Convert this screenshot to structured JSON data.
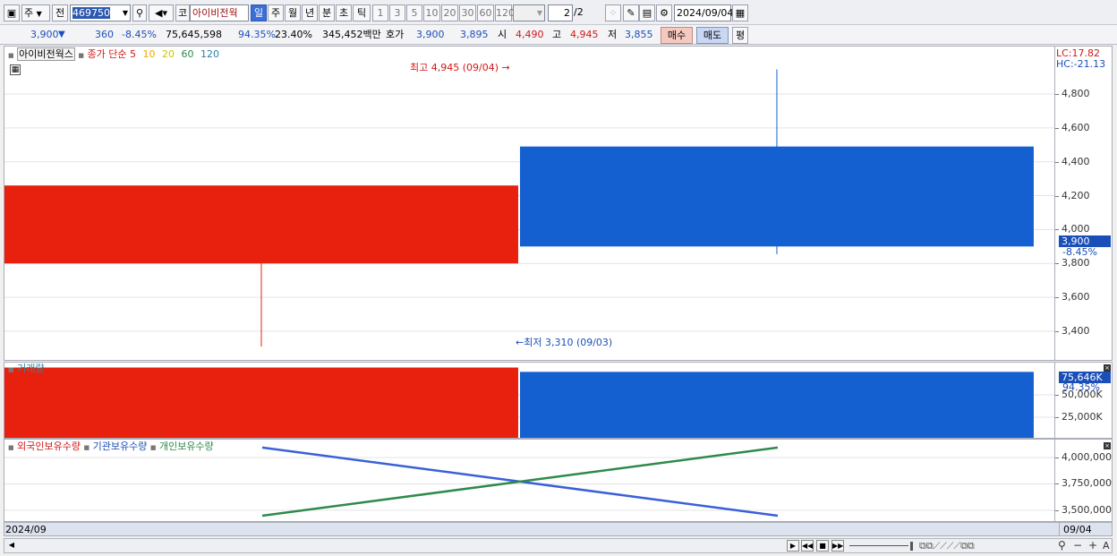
{
  "toolbar": {
    "market": "주",
    "prev": "전",
    "code": "469750",
    "market_type": "코",
    "stock_name": "아이비전웍",
    "periods": [
      "일",
      "주",
      "월",
      "년",
      "분",
      "초",
      "틱"
    ],
    "selected_period": "일",
    "intervals": [
      "1",
      "3",
      "5",
      "10",
      "20",
      "30",
      "60",
      "120"
    ],
    "page": "2",
    "page_total": "/2",
    "date": "2024/09/04"
  },
  "quote": {
    "price": "3,900",
    "arrow": "▼",
    "change": "360",
    "change_pct": "-8.45%",
    "volume": "75,645,598",
    "vol_ratio": "94.35%",
    "turnover": "23.40%",
    "amount": "345,452백만",
    "hoga_label": "호가",
    "ask": "3,900",
    "bid": "3,895",
    "open_label": "시",
    "open": "4,490",
    "high_label": "고",
    "high": "4,945",
    "low_label": "저",
    "low": "3,855",
    "buy_label": "매수",
    "sell_label": "매도",
    "flat_label": "평"
  },
  "price_pane": {
    "stock_label": "아이비전웍스",
    "ma_label": "종가 단순",
    "ma_periods": [
      "5",
      "10",
      "20",
      "60",
      "120"
    ],
    "ma_colors": [
      "#d01818",
      "#f0a800",
      "#c8c800",
      "#2e8a4a",
      "#2a7fb0"
    ],
    "high_annotation": "최고 4,945 (09/04)",
    "low_annotation": "최저 3,310 (09/03)",
    "lc": "LC:17.82",
    "hc": "HC:-21.13",
    "current_tag": "3,900",
    "current_pct": "-8.45%"
  },
  "volume_pane": {
    "label": "거래량",
    "current_tag": "75,646K",
    "ratio": "94.35%"
  },
  "holdings_pane": {
    "legend": [
      "외국인보유수량",
      "기관보유수량",
      "개인보유수량"
    ],
    "legend_colors": [
      "#d01818",
      "#1b4fb8",
      "#2e8a4a"
    ]
  },
  "footer": {
    "left_date": "2024/09",
    "right_date": "09/04"
  },
  "chart_data": [
    {
      "type": "candlestick",
      "categories": [
        "09/03",
        "09/04"
      ],
      "candles": [
        {
          "date": "09/03",
          "open": 3800,
          "high": 4260,
          "low": 3310,
          "close": 4260,
          "color": "#e8200e"
        },
        {
          "date": "09/04",
          "open": 4490,
          "high": 4945,
          "low": 3855,
          "close": 3900,
          "color": "#1560d0"
        }
      ],
      "yticks": [
        3400,
        3600,
        3800,
        4000,
        4200,
        4400,
        4600,
        4800
      ],
      "ytick_labels": [
        "3,400",
        "3,600",
        "3,800",
        "4,000",
        "4,200",
        "4,400",
        "4,600",
        "4,800"
      ],
      "ylim": [
        3220,
        5080
      ]
    },
    {
      "type": "bar",
      "categories": [
        "09/03",
        "09/04"
      ],
      "values": [
        80500,
        75646
      ],
      "colors": [
        "#e8200e",
        "#1560d0"
      ],
      "yticks": [
        25000,
        50000
      ],
      "ytick_labels": [
        "25,000K",
        "50,000K"
      ],
      "ylim": [
        0,
        86000
      ]
    },
    {
      "type": "line",
      "x": [
        "09/03",
        "09/04"
      ],
      "series": [
        {
          "name": "기관보유수량",
          "values": [
            4095000,
            3448000
          ],
          "color": "#3a60d8"
        },
        {
          "name": "개인보유수량",
          "values": [
            3448000,
            4095000
          ],
          "color": "#2e8a4a"
        }
      ],
      "yticks": [
        3500000,
        3750000,
        4000000
      ],
      "ytick_labels": [
        "3,500,000",
        "3,750,000",
        "4,000,000"
      ],
      "ylim": [
        3380000,
        4170000
      ]
    }
  ]
}
